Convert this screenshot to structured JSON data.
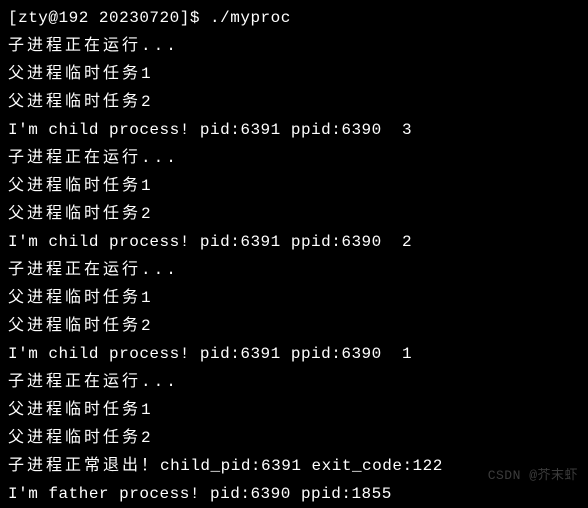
{
  "terminal": {
    "prompt": "[zty@192 20230720]$ ",
    "command": "./myproc",
    "lines": [
      {
        "type": "cmd"
      },
      {
        "type": "cjk",
        "text": "子进程正在运行..."
      },
      {
        "type": "cjk",
        "text": "父进程临时任务1"
      },
      {
        "type": "cjk",
        "text": "父进程临时任务2"
      },
      {
        "type": "plain",
        "text": "I'm child process! pid:6391 ppid:6390  3"
      },
      {
        "type": "cjk",
        "text": "子进程正在运行..."
      },
      {
        "type": "cjk",
        "text": "父进程临时任务1"
      },
      {
        "type": "cjk",
        "text": "父进程临时任务2"
      },
      {
        "type": "plain",
        "text": "I'm child process! pid:6391 ppid:6390  2"
      },
      {
        "type": "cjk",
        "text": "子进程正在运行..."
      },
      {
        "type": "cjk",
        "text": "父进程临时任务1"
      },
      {
        "type": "cjk",
        "text": "父进程临时任务2"
      },
      {
        "type": "plain",
        "text": "I'm child process! pid:6391 ppid:6390  1"
      },
      {
        "type": "cjk",
        "text": "子进程正在运行..."
      },
      {
        "type": "cjk",
        "text": "父进程临时任务1"
      },
      {
        "type": "cjk",
        "text": "父进程临时任务2"
      },
      {
        "type": "mixed",
        "cjk": "子进程正常退出！",
        "rest": "child_pid:6391 exit_code:122"
      },
      {
        "type": "plain",
        "text": "I'm father process! pid:6390 ppid:1855"
      }
    ]
  },
  "watermark": "CSDN @芥末虾"
}
